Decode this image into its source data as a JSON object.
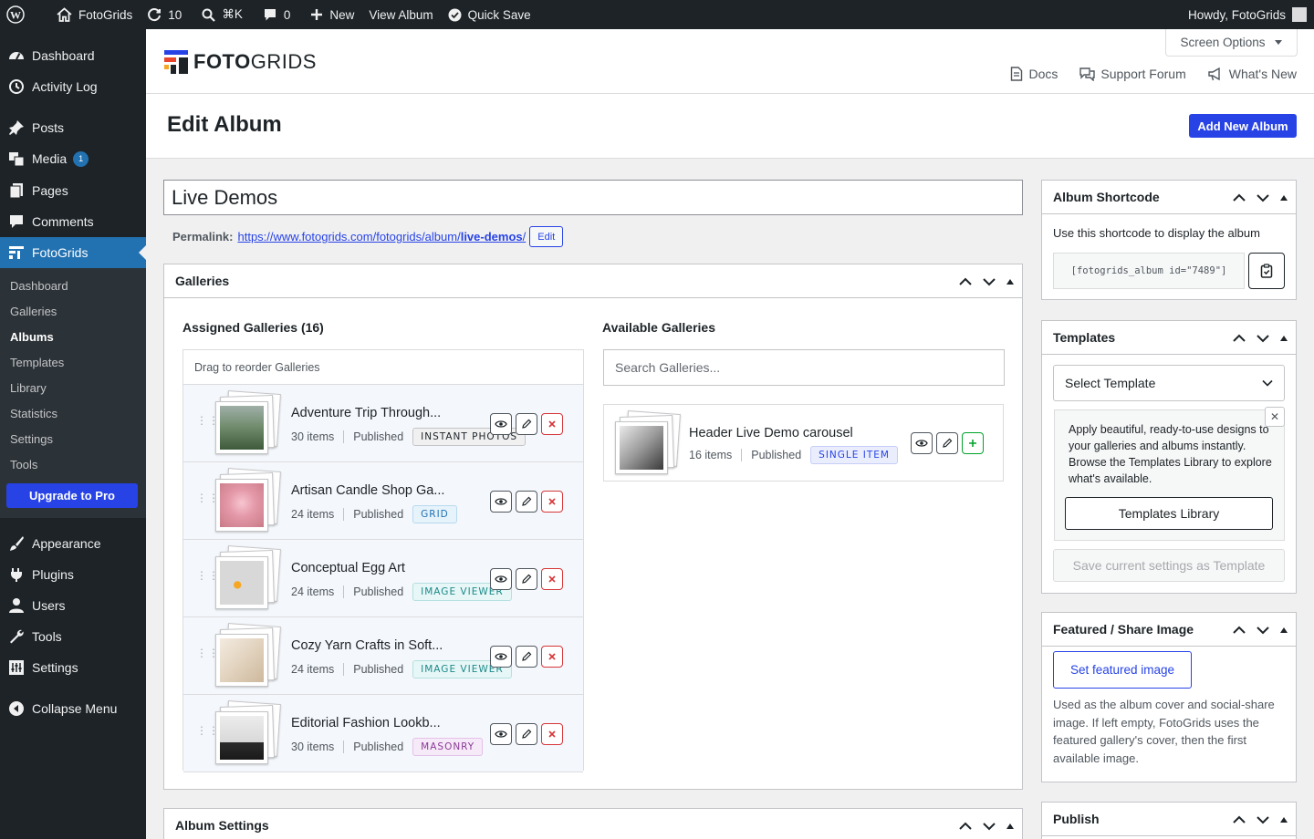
{
  "adminbar": {
    "site_name": "FotoGrids",
    "updates_count": "10",
    "search_shortcut": "⌘K",
    "comments_count": "0",
    "new_label": "New",
    "view_album_label": "View Album",
    "quick_save_label": "Quick Save",
    "howdy": "Howdy, FotoGrids"
  },
  "sidebar": {
    "items": [
      {
        "label": "Dashboard",
        "icon": "dashboard-icon"
      },
      {
        "label": "Activity Log",
        "icon": "history-icon"
      },
      {
        "label": "Posts",
        "icon": "pin-icon"
      },
      {
        "label": "Media",
        "icon": "media-icon",
        "badge": "1"
      },
      {
        "label": "Pages",
        "icon": "pages-icon"
      },
      {
        "label": "Comments",
        "icon": "comments-icon"
      },
      {
        "label": "FotoGrids",
        "icon": "fotogrids-icon"
      },
      {
        "label": "Appearance",
        "icon": "brush-icon"
      },
      {
        "label": "Plugins",
        "icon": "plug-icon"
      },
      {
        "label": "Users",
        "icon": "user-icon"
      },
      {
        "label": "Tools",
        "icon": "wrench-icon"
      },
      {
        "label": "Settings",
        "icon": "settings-icon"
      },
      {
        "label": "Collapse Menu",
        "icon": "collapse-icon"
      }
    ],
    "submenu": [
      "Dashboard",
      "Galleries",
      "Albums",
      "Templates",
      "Library",
      "Statistics",
      "Settings",
      "Tools"
    ],
    "upgrade_label": "Upgrade to Pro"
  },
  "header": {
    "screen_options": "Screen Options",
    "logo_bold": "FOTO",
    "logo_light": "GRIDS",
    "docs": "Docs",
    "support": "Support Forum",
    "whats_new": "What's New"
  },
  "page": {
    "title": "Edit Album",
    "add_new": "Add New Album",
    "album_title": "Live Demos",
    "permalink_label": "Permalink:",
    "permalink_base": "https://www.fotogrids.com/fotogrids/album/",
    "permalink_slug": "live-demos",
    "permalink_trail": "/",
    "permalink_edit": "Edit"
  },
  "galleries_box": {
    "title": "Galleries",
    "assigned_title": "Assigned Galleries (16)",
    "drag_hint": "Drag to reorder Galleries",
    "available_title": "Available Galleries",
    "search_placeholder": "Search Galleries...",
    "assigned": [
      {
        "name": "Adventure Trip Through...",
        "items": "30 items",
        "status": "Published",
        "tag": "INSTANT PHOTOS",
        "tag_bg": "#f0f0f1",
        "tag_fg": "#1d2327",
        "tag_border": "#c3c4c7",
        "thumb": "linear-gradient(180deg,#9fb0a8 0%,#6f8a6a 50%,#3e5a3a 100%)"
      },
      {
        "name": "Artisan Candle Shop Ga...",
        "items": "24 items",
        "status": "Published",
        "tag": "GRID",
        "tag_bg": "#e6f3fb",
        "tag_fg": "#2271b1",
        "tag_border": "#b7d9f0",
        "thumb": "radial-gradient(circle at 50% 45%,#f7c6d0 0%,#e59aaa 40%,#c97a86 100%)"
      },
      {
        "name": "Conceptual Egg Art",
        "items": "24 items",
        "status": "Published",
        "tag": "IMAGE VIEWER",
        "tag_bg": "#e7f6f6",
        "tag_fg": "#1c8a8a",
        "tag_border": "#b5e0e0",
        "thumb": "radial-gradient(circle at 40% 55%,#f5a623 0 10%,#d8d8d8 11% 100%)"
      },
      {
        "name": "Cozy Yarn Crafts in Soft...",
        "items": "24 items",
        "status": "Published",
        "tag": "IMAGE VIEWER",
        "tag_bg": "#e7f6f6",
        "tag_fg": "#1c8a8a",
        "tag_border": "#b5e0e0",
        "thumb": "linear-gradient(135deg,#f3ebe0 0%,#e2d3bf 50%,#cdb89c 100%)"
      },
      {
        "name": "Editorial Fashion Lookb...",
        "items": "30 items",
        "status": "Published",
        "tag": "MASONRY",
        "tag_bg": "#f6e9f8",
        "tag_fg": "#8a3c96",
        "tag_border": "#e3c2e8",
        "thumb": "linear-gradient(180deg,#ececec 0%,#d9d9d9 60%,#2c2c2c 60%,#1a1a1a 100%)"
      }
    ],
    "available": [
      {
        "name": "Header Live Demo carousel",
        "items": "16 items",
        "status": "Published",
        "tag": "SINGLE ITEM",
        "tag_bg": "#eaedfc",
        "tag_fg": "#2743e6",
        "tag_border": "#c6cef7",
        "thumb": "linear-gradient(135deg,#eaeaea 0%,#9a9a9a 50%,#3a3a3a 100%)"
      }
    ]
  },
  "album_settings": {
    "title": "Album Settings"
  },
  "shortcode_box": {
    "title": "Album Shortcode",
    "desc": "Use this shortcode to display the album",
    "shortcode": "[fotogrids_album id=\"7489\"]"
  },
  "templates_box": {
    "title": "Templates",
    "select_label": "Select Template",
    "notice": "Apply beautiful, ready-to-use designs to your galleries and albums instantly. Browse the Templates Library to explore what's available.",
    "library_btn": "Templates Library",
    "save_btn": "Save current settings as Template"
  },
  "featured_box": {
    "title": "Featured / Share Image",
    "set_btn": "Set featured image",
    "desc": "Used as the album cover and social-share image. If left empty, FotoGrids uses the featured gallery's cover, then the first available image."
  },
  "publish_box": {
    "title": "Publish"
  },
  "colors": {
    "accent": "#2743e6",
    "wp_dark": "#1d2327",
    "wp_blue": "#2271b1"
  }
}
